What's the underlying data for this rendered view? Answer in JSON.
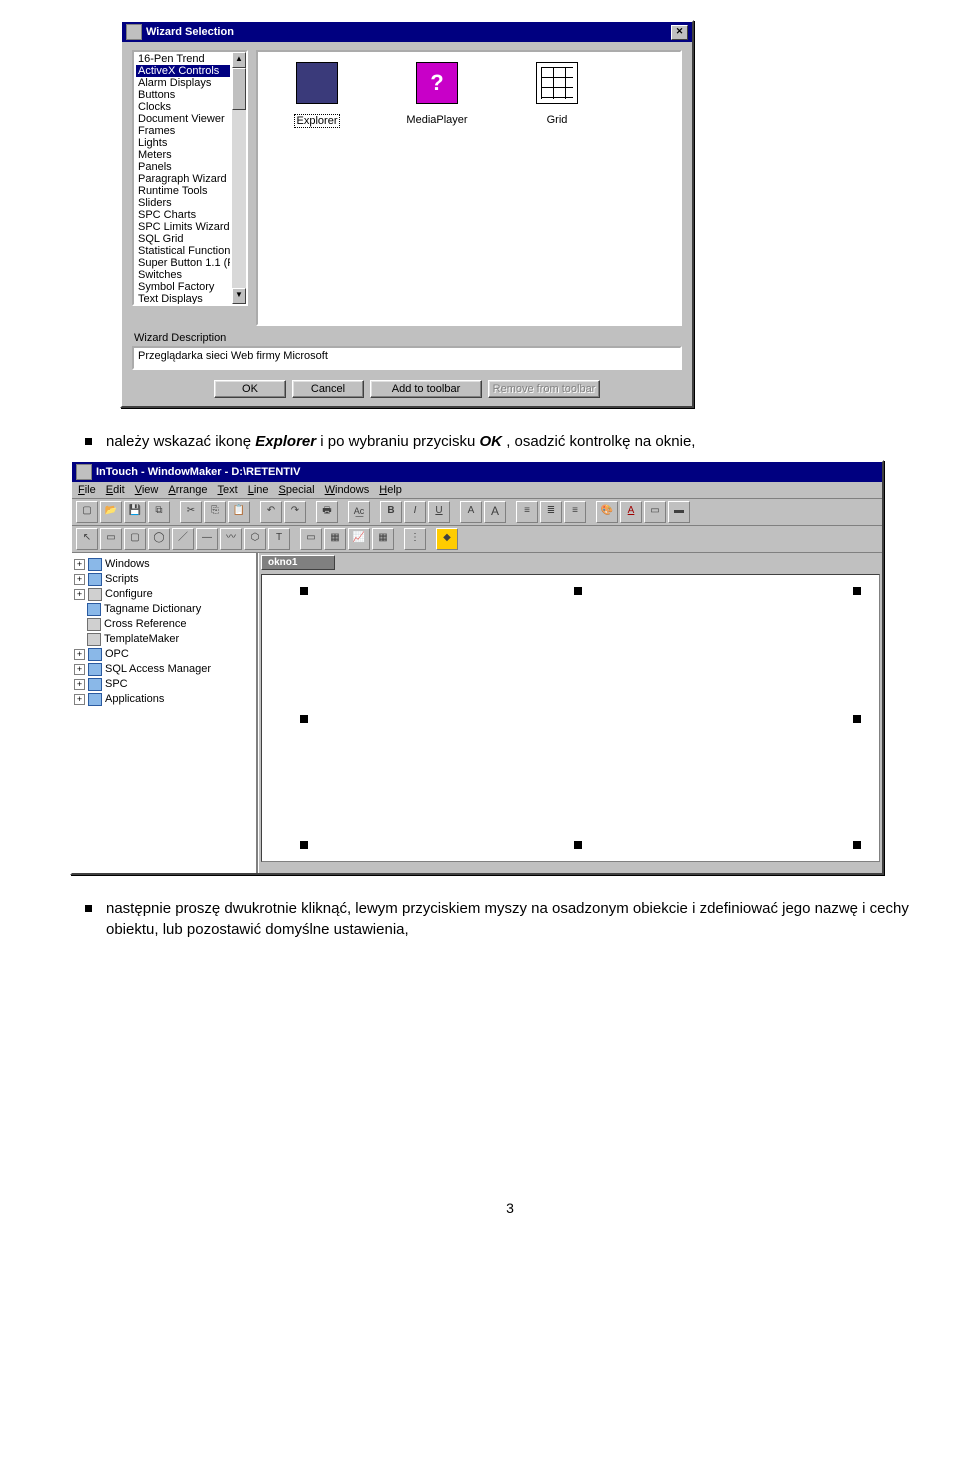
{
  "wizard": {
    "title": "Wizard Selection",
    "list": [
      "16-Pen Trend",
      "ActiveX Controls",
      "Alarm Displays",
      "Buttons",
      "Clocks",
      "Document Viewer",
      "Frames",
      "Lights",
      "Meters",
      "Panels",
      "Paragraph Wizard",
      "Runtime Tools",
      "Sliders",
      "SPC Charts",
      "SPC Limits Wizard",
      "SQL Grid",
      "Statistical Function",
      "Super Button 1.1 (F",
      "Switches",
      "Symbol Factory",
      "Text Displays"
    ],
    "selected_index": 1,
    "icons": {
      "explorer": "Explorer",
      "media": "MediaPlayer",
      "grid": "Grid"
    },
    "selected_icon": "explorer",
    "desc_label": "Wizard Description",
    "description": "Przeglądarka sieci Web firmy Microsoft",
    "buttons": {
      "ok": "OK",
      "cancel": "Cancel",
      "add": "Add to toolbar",
      "remove": "Remove from toolbar"
    }
  },
  "bullet1_pre": "należy wskazać ikonę ",
  "bullet1_explorer": "Explorer",
  "bullet1_mid": " i po wybraniu przycisku ",
  "bullet1_ok": "OK",
  "bullet1_post": ", osadzić kontrolkę na oknie,",
  "win2": {
    "title": "InTouch - WindowMaker - D:\\RETENTIV",
    "menu": [
      "File",
      "Edit",
      "View",
      "Arrange",
      "Text",
      "Line",
      "Special",
      "Windows",
      "Help"
    ],
    "tree": [
      {
        "exp": "+",
        "icon": "blue",
        "label": "Windows"
      },
      {
        "exp": "+",
        "icon": "blue",
        "label": "Scripts"
      },
      {
        "exp": "+",
        "icon": "gray",
        "label": "Configure"
      },
      {
        "exp": "",
        "icon": "blue",
        "label": "Tagname Dictionary"
      },
      {
        "exp": "",
        "icon": "gray",
        "label": "Cross Reference"
      },
      {
        "exp": "",
        "icon": "gray",
        "label": "TemplateMaker"
      },
      {
        "exp": "+",
        "icon": "blue",
        "label": "OPC"
      },
      {
        "exp": "+",
        "icon": "blue",
        "label": "SQL Access Manager"
      },
      {
        "exp": "+",
        "icon": "blue",
        "label": "SPC"
      },
      {
        "exp": "+",
        "icon": "blue",
        "label": "Applications"
      }
    ],
    "canvas_tab": "okno1"
  },
  "bullet2": "następnie proszę dwukrotnie kliknąć, lewym przyciskiem myszy na osadzonym obiekcie i zdefiniować jego nazwę i cechy obiektu, lub pozostawić domyślne ustawienia,",
  "page_number": "3"
}
